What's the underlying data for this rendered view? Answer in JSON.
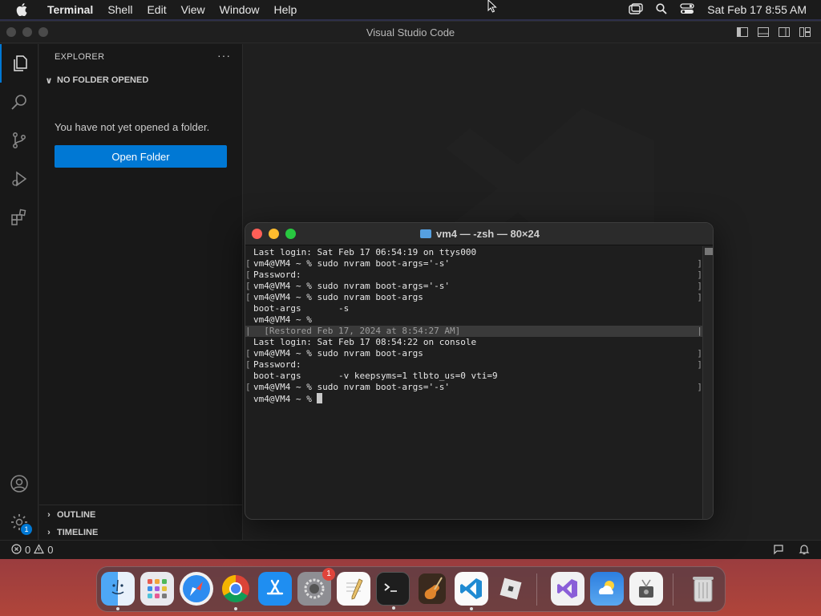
{
  "menubar": {
    "app": "Terminal",
    "items": [
      "Shell",
      "Edit",
      "View",
      "Window",
      "Help"
    ],
    "clock": "Sat Feb 17  8:55 AM"
  },
  "vscode": {
    "title": "Visual Studio Code",
    "sidebar": {
      "title": "EXPLORER",
      "more": "···",
      "no_folder_header": "NO FOLDER OPENED",
      "message": "You have not yet opened a folder.",
      "open_folder_label": "Open Folder",
      "outline_label": "OUTLINE",
      "timeline_label": "TIMELINE"
    },
    "activity": {
      "settings_badge": "1"
    },
    "statusbar": {
      "errors": "0",
      "warnings": "0"
    }
  },
  "terminal": {
    "title": "vm4 — -zsh — 80×24",
    "lines": [
      "Last login: Sat Feb 17 06:54:19 on ttys000",
      "vm4@VM4 ~ % sudo nvram boot-args='-s'",
      "Password:",
      "vm4@VM4 ~ % sudo nvram boot-args='-s'",
      "vm4@VM4 ~ % sudo nvram boot-args",
      "boot-args\t-s",
      "vm4@VM4 ~ % ",
      "  [Restored Feb 17, 2024 at 8:54:27 AM]",
      "Last login: Sat Feb 17 08:54:22 on console",
      "vm4@VM4 ~ % sudo nvram boot-args",
      "Password:",
      "boot-args\t-v keepsyms=1 tlbto_us=0 vti=9",
      "vm4@VM4 ~ % sudo nvram boot-args='-s'",
      "vm4@VM4 ~ % "
    ]
  },
  "dock": {
    "apps": [
      "Finder",
      "Launchpad",
      "Safari",
      "Google Chrome",
      "App Store",
      "System Settings",
      "TextEdit",
      "Terminal",
      "GarageBand",
      "Visual Studio Code",
      "Roblox",
      "Visual Studio",
      "Weather",
      "Disk Utility",
      "Trash"
    ],
    "settings_badge": "1"
  },
  "colors": {
    "accent": "#0078d4",
    "close": "#ff5f57",
    "minimize": "#febc2e",
    "zoom": "#28c840"
  }
}
